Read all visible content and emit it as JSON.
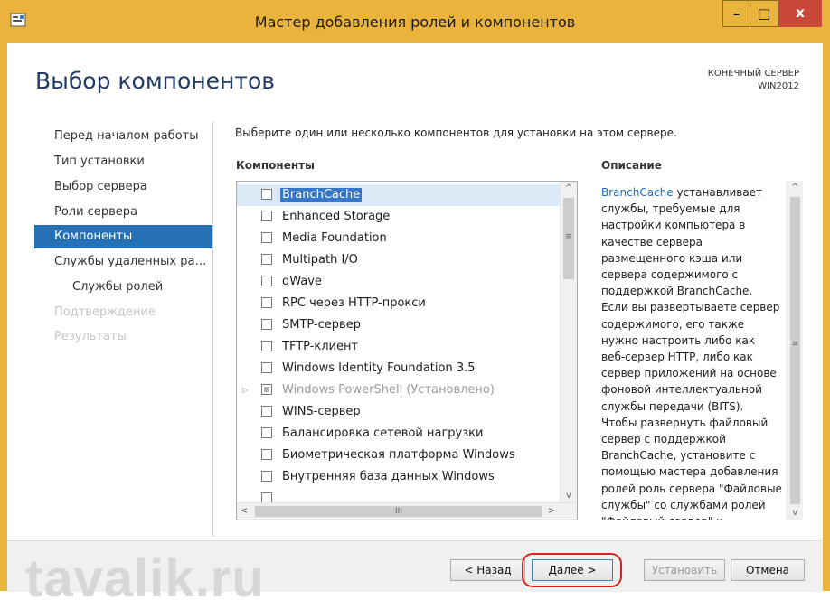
{
  "window": {
    "title": "Мастер добавления ролей и компонентов",
    "controls": {
      "minimize": "–",
      "maximize": "□",
      "close": "x"
    }
  },
  "header": {
    "page_title": "Выбор компонентов",
    "destination_label": "КОНЕЧНЫЙ СЕРВЕР",
    "destination_server": "WIN2012"
  },
  "nav": {
    "items": [
      {
        "label": "Перед началом работы",
        "state": "normal"
      },
      {
        "label": "Тип установки",
        "state": "normal"
      },
      {
        "label": "Выбор сервера",
        "state": "normal"
      },
      {
        "label": "Роли сервера",
        "state": "normal"
      },
      {
        "label": "Компоненты",
        "state": "active"
      },
      {
        "label": "Службы удаленных рабо...",
        "state": "normal"
      },
      {
        "label": "Службы ролей",
        "state": "sub"
      },
      {
        "label": "Подтверждение",
        "state": "disabled"
      },
      {
        "label": "Результаты",
        "state": "disabled"
      }
    ]
  },
  "main": {
    "instruction": "Выберите один или несколько компонентов для установки на этом сервере.",
    "components_header": "Компоненты",
    "description_header": "Описание",
    "components": [
      {
        "label": "BranchCache",
        "selected": true
      },
      {
        "label": "Enhanced Storage"
      },
      {
        "label": "Media Foundation"
      },
      {
        "label": "Multipath I/O"
      },
      {
        "label": "qWave"
      },
      {
        "label": "RPC через HTTP-прокси"
      },
      {
        "label": "SMTP-сервер"
      },
      {
        "label": "TFTP-клиент"
      },
      {
        "label": "Windows Identity Foundation 3.5"
      },
      {
        "label": "Windows PowerShell (Установлено)",
        "installed": true
      },
      {
        "label": "WINS-сервер"
      },
      {
        "label": "Балансировка сетевой нагрузки"
      },
      {
        "label": "Биометрическая платформа Windows"
      },
      {
        "label": "Внутренняя база данных Windows"
      }
    ],
    "description_link": "BranchCache",
    "description_text": " устанавливает службы, требуемые для настройки компьютера в качестве сервера размещенного кэша или сервера содержимого с поддержкой BranchCache. Если вы развертываете сервер содержимого, его также нужно настроить либо как веб-сервер HTTP, либо как сервер приложений на основе фоновой интеллектуальной службы передачи (BITS). Чтобы развернуть файловый сервер с поддержкой BranchCache, установите с помощью мастера добавления ролей роль сервера \"Файловые службы\" со службами ролей \"Файловый сервер\" и \"\"BranchCache для"
  },
  "scrollbars": {
    "up_arrow": "^",
    "down_arrow": "v",
    "left_arrow": "<",
    "right_arrow": ">",
    "vertical_grip": "≡",
    "horizontal_grip": "III"
  },
  "footer": {
    "watermark": "tavalik.ru",
    "back_label": "< Назад",
    "next_label": "Далее >",
    "install_label": "Установить",
    "cancel_label": "Отмена"
  },
  "colors": {
    "titlebar": "#eab43c",
    "active_nav": "#2671b6",
    "highlight_circle": "#d9221f",
    "link": "#1a6fc2"
  }
}
